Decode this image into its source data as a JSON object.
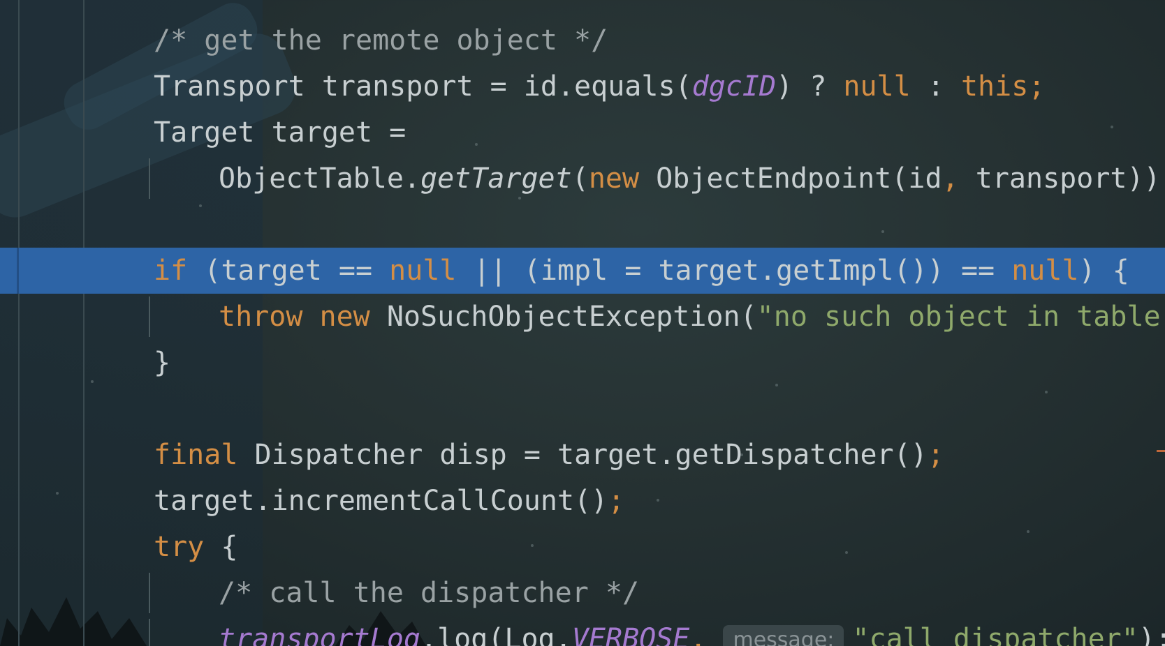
{
  "editor": {
    "lines": [
      {
        "tokens": [
          {
            "t": "/* get the remote object */",
            "c": "cm"
          }
        ]
      },
      {
        "tokens": [
          {
            "t": "Transport transport = id.equals(",
            "c": "plain"
          },
          {
            "t": "dgcID",
            "c": "purple it"
          },
          {
            "t": ") ? ",
            "c": "plain"
          },
          {
            "t": "null",
            "c": "kw"
          },
          {
            "t": " : ",
            "c": "plain"
          },
          {
            "t": "this;",
            "c": "kw"
          }
        ]
      },
      {
        "tokens": [
          {
            "t": "Target target =",
            "c": "plain"
          }
        ]
      },
      {
        "indent": true,
        "tokens": [
          {
            "t": "ObjectTable.",
            "c": "plain"
          },
          {
            "t": "getTarget",
            "c": "plain it"
          },
          {
            "t": "(",
            "c": "plain"
          },
          {
            "t": "new",
            "c": "kw"
          },
          {
            "t": " ObjectEndpoint(id",
            "c": "plain"
          },
          {
            "t": ",",
            "c": "kw"
          },
          {
            "t": " transport))",
            "c": "plain"
          },
          {
            "t": ";",
            "c": "kw"
          }
        ]
      },
      {
        "tokens": []
      },
      {
        "highlight": true,
        "tokens": [
          {
            "t": "if",
            "c": "kw"
          },
          {
            "t": " (target == ",
            "c": "plain"
          },
          {
            "t": "null",
            "c": "kw"
          },
          {
            "t": " || (impl = target.getImpl()) == ",
            "c": "plain"
          },
          {
            "t": "null",
            "c": "kw"
          },
          {
            "t": ") {",
            "c": "plain"
          }
        ]
      },
      {
        "indent": true,
        "tokens": [
          {
            "t": "throw",
            "c": "kw"
          },
          {
            "t": " ",
            "c": "plain"
          },
          {
            "t": "new",
            "c": "kw"
          },
          {
            "t": " NoSuchObjectException(",
            "c": "plain"
          },
          {
            "t": "\"no such object in table\"",
            "c": "st"
          },
          {
            "t": ");",
            "c": "plain"
          }
        ]
      },
      {
        "tokens": [
          {
            "t": "}",
            "c": "plain"
          }
        ]
      },
      {
        "tokens": []
      },
      {
        "tokens": [
          {
            "t": "final",
            "c": "kw"
          },
          {
            "t": " Dispatcher disp = target.getDispatcher()",
            "c": "plain"
          },
          {
            "t": ";",
            "c": "kw"
          }
        ]
      },
      {
        "tokens": [
          {
            "t": "target.incrementCallCount()",
            "c": "plain"
          },
          {
            "t": ";",
            "c": "kw"
          }
        ]
      },
      {
        "tokens": [
          {
            "t": "try",
            "c": "kw"
          },
          {
            "t": " {",
            "c": "plain"
          }
        ]
      },
      {
        "indent": true,
        "tokens": [
          {
            "t": "/* call the dispatcher */",
            "c": "cm"
          }
        ]
      },
      {
        "indent": true,
        "tokens": [
          {
            "t": "transportLog",
            "c": "purple it"
          },
          {
            "t": ".log(Log.",
            "c": "plain"
          },
          {
            "t": "VERBOSE",
            "c": "purple it"
          },
          {
            "t": ", ",
            "c": "kw"
          },
          {
            "hint": "message:"
          },
          {
            "t": "\"call dispatcher\"",
            "c": "st"
          },
          {
            "t": ");",
            "c": "plain"
          }
        ]
      }
    ]
  }
}
